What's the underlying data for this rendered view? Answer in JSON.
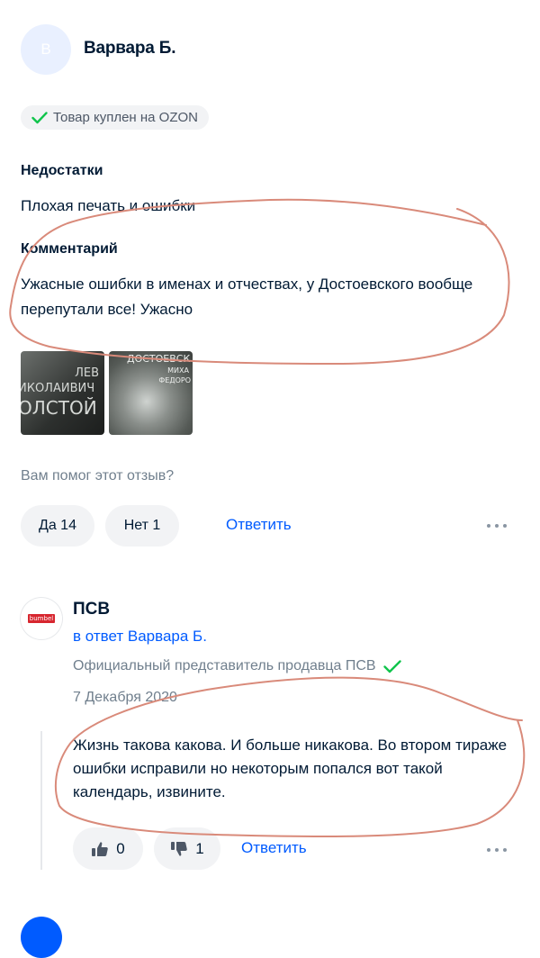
{
  "review": {
    "avatar_letter": "B",
    "author": "Варвара Б.",
    "badge": "Товар куплен на OZON",
    "cons_title": "Недостатки",
    "cons_text": "Плохая печать и ошибки",
    "comment_title": "Комментарий",
    "comment_text": "Ужасные ошибки в именах и отчествах, у Достоевского вообще перепутали все! Ужасно",
    "photos": [
      {
        "lines": [
          "ЛЕВ",
          "ИКОЛАИВИЧ",
          "ОЛСТОЙ"
        ]
      },
      {
        "lines": [
          "ДОСТОЕВСК",
          "МИХА",
          "ФЕДОРО"
        ]
      }
    ],
    "helpful_question": "Вам помог этот отзыв?",
    "yes_label": "Да 14",
    "no_label": "Нет 1",
    "reply_label": "Ответить"
  },
  "seller_reply": {
    "logo_text": "bumbel",
    "name": "ПСВ",
    "reply_to": "в ответ Варвара Б.",
    "official_label": "Официальный представитель продавца ПСВ",
    "date": "7 Декабря 2020",
    "text": "Жизнь такова какова. И больше никакова. Во втором тираже ошибки исправили но некоторым попался вот такой календарь, извините.",
    "likes": "0",
    "dislikes": "1",
    "reply_label": "Ответить"
  },
  "colors": {
    "accent": "#005bff",
    "success": "#10c44c",
    "annotation": "#d98a7a"
  }
}
